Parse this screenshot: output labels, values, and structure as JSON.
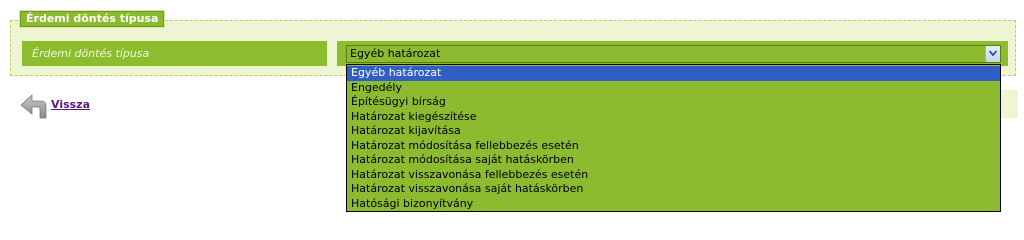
{
  "section": {
    "legend": "Érdemi döntés típusa",
    "field_label": "Érdemi döntés típusa",
    "select_value": "Egyéb határozat",
    "options": [
      "Egyéb határozat",
      "Engedély",
      "Építésügyi bírság",
      "Határozat kiegészítése",
      "Határozat kijavítása",
      "Határozat módosítása fellebbezés esetén",
      "Határozat módosítása saját hatáskörben",
      "Határozat visszavonása fellebbezés esetén",
      "Határozat visszavonása saját hatáskörben",
      "Hatósági bizonyítvány"
    ],
    "selected_index": 0
  },
  "nav": {
    "back_label": "Vissza",
    "back_icon": "arrow-left-icon"
  },
  "colors": {
    "accent_green": "#8bbd2f",
    "panel_bg": "#eef5d2",
    "selection_blue": "#2f5fc4",
    "link_purple": "#5a1a7a"
  }
}
